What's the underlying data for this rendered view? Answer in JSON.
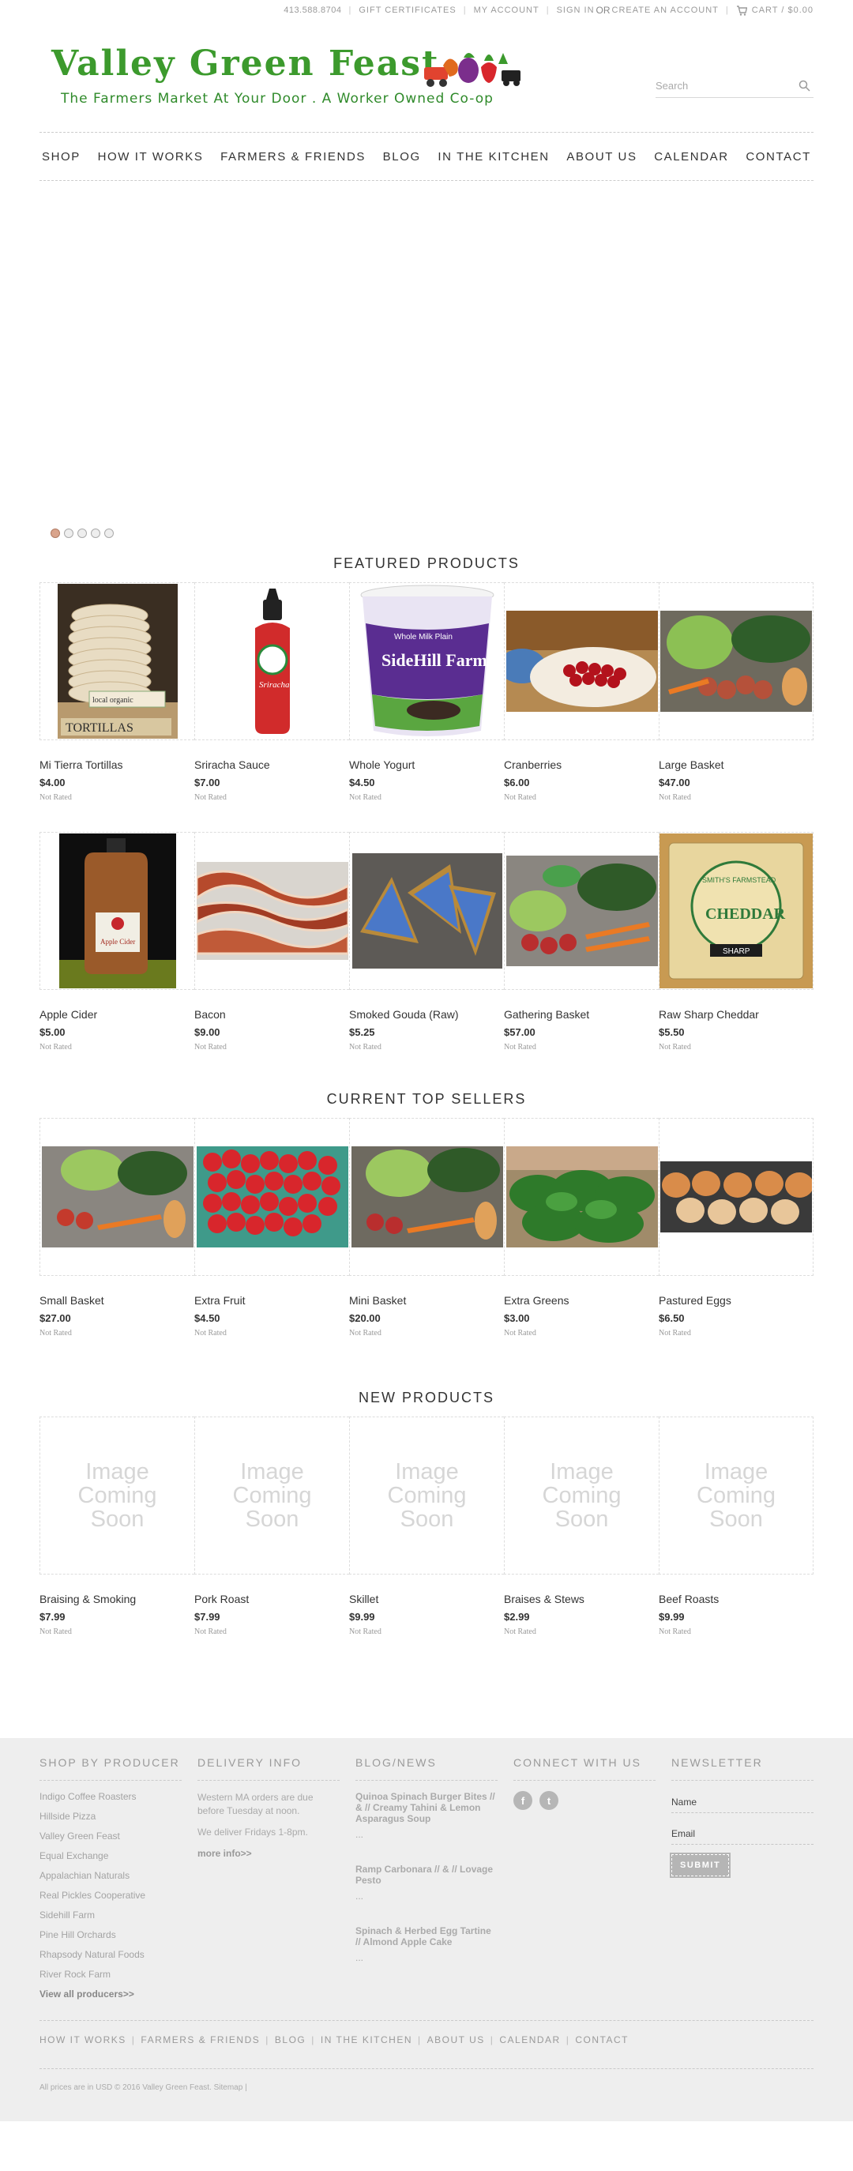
{
  "topbar": {
    "phone": "413.588.8704",
    "gift": "GIFT CERTIFICATES",
    "account": "MY ACCOUNT",
    "signin": "SIGN IN",
    "or": "OR",
    "create": "CREATE AN ACCOUNT",
    "cart": "CART / $0.00"
  },
  "header": {
    "logo_title": "Valley Green Feast",
    "logo_tagline": "The Farmers Market At Your Door .  A Worker Owned Co-op",
    "search_placeholder": "Search"
  },
  "nav": [
    "SHOP",
    "HOW IT WORKS",
    "FARMERS & FRIENDS",
    "BLOG",
    "IN THE KITCHEN",
    "ABOUT US",
    "CALENDAR",
    "CONTACT"
  ],
  "slider": {
    "dot_count": 5,
    "active": 0
  },
  "featured": {
    "title": "FEATURED PRODUCTS",
    "rows": [
      [
        {
          "name": "Mi Tierra Tortillas",
          "price": "$4.00",
          "rating": "Not Rated"
        },
        {
          "name": "Sriracha Sauce",
          "price": "$7.00",
          "rating": "Not Rated"
        },
        {
          "name": "Whole Yogurt",
          "price": "$4.50",
          "rating": "Not Rated"
        },
        {
          "name": "Cranberries",
          "price": "$6.00",
          "rating": "Not Rated"
        },
        {
          "name": "Large Basket",
          "price": "$47.00",
          "rating": "Not Rated"
        }
      ],
      [
        {
          "name": "Apple Cider",
          "price": "$5.00",
          "rating": "Not Rated"
        },
        {
          "name": "Bacon",
          "price": "$9.00",
          "rating": "Not Rated"
        },
        {
          "name": "Smoked Gouda (Raw)",
          "price": "$5.25",
          "rating": "Not Rated"
        },
        {
          "name": "Gathering Basket",
          "price": "$57.00",
          "rating": "Not Rated"
        },
        {
          "name": "Raw Sharp Cheddar",
          "price": "$5.50",
          "rating": "Not Rated"
        }
      ]
    ]
  },
  "image_text": {
    "tortilla_label": "TORTILLAS",
    "tortilla_note": "local  organic",
    "sriracha_label": "Sriracha",
    "yogurt_top": "Whole Milk Plain",
    "yogurt_brand": "SideHill Farm",
    "cheddar_top": "SMITH'S FARMSTEAD",
    "cheddar_main": "CHEDDAR",
    "cheddar_band": "SHARP",
    "cider_label": "Apple Cider"
  },
  "top_sellers": {
    "title": "CURRENT TOP SELLERS",
    "items": [
      {
        "name": "Small Basket",
        "price": "$27.00",
        "rating": "Not Rated"
      },
      {
        "name": "Extra Fruit",
        "price": "$4.50",
        "rating": "Not Rated"
      },
      {
        "name": "Mini Basket",
        "price": "$20.00",
        "rating": "Not Rated"
      },
      {
        "name": "Extra Greens",
        "price": "$3.00",
        "rating": "Not Rated"
      },
      {
        "name": "Pastured Eggs",
        "price": "$6.50",
        "rating": "Not Rated"
      }
    ]
  },
  "new_products": {
    "title": "NEW PRODUCTS",
    "placeholder": [
      "Image",
      "Coming",
      "Soon"
    ],
    "items": [
      {
        "name": "Braising & Smoking",
        "price": "$7.99",
        "rating": "Not Rated"
      },
      {
        "name": "Pork Roast",
        "price": "$7.99",
        "rating": "Not Rated"
      },
      {
        "name": "Skillet",
        "price": "$9.99",
        "rating": "Not Rated"
      },
      {
        "name": "Braises & Stews",
        "price": "$2.99",
        "rating": "Not Rated"
      },
      {
        "name": "Beef Roasts",
        "price": "$9.99",
        "rating": "Not Rated"
      }
    ]
  },
  "footer": {
    "shop_by_producer": {
      "title": "SHOP BY PRODUCER",
      "items": [
        "Indigo Coffee Roasters",
        "Hillside Pizza",
        "Valley Green Feast",
        "Equal Exchange",
        "Appalachian Naturals",
        "Real Pickles Cooperative",
        "Sidehill Farm",
        "Pine Hill Orchards",
        "Rhapsody Natural Foods",
        "River Rock Farm"
      ],
      "more": "View all producers>>"
    },
    "delivery": {
      "title": "DELIVERY INFO",
      "line1": "Western MA orders are due before Tuesday at noon.",
      "line2": "We deliver Fridays 1-8pm.",
      "more": "more info>>"
    },
    "blog": {
      "title": "BLOG/NEWS",
      "posts": [
        "Quinoa Spinach Burger Bites // & // Creamy Tahini & Lemon Asparagus Soup",
        "Ramp Carbonara // & // Lovage Pesto",
        "Spinach & Herbed Egg Tartine // Almond Apple Cake"
      ],
      "ellipsis": "..."
    },
    "connect": {
      "title": "CONNECT WITH US",
      "facebook": "f",
      "twitter": "t"
    },
    "newsletter": {
      "title": "NEWSLETTER",
      "name_placeholder": "Name",
      "email_placeholder": "Email",
      "submit": "SUBMIT"
    },
    "nav": [
      "HOW IT WORKS",
      "FARMERS & FRIENDS",
      "BLOG",
      "IN THE KITCHEN",
      "ABOUT US",
      "CALENDAR",
      "CONTACT"
    ],
    "copyright": "All prices are in USD © 2016 Valley Green Feast. Sitemap |"
  },
  "colors": {
    "brand_green": "#3c9a2d",
    "footer_bg": "#eeeeee",
    "button_gray": "#b5b5b5"
  }
}
